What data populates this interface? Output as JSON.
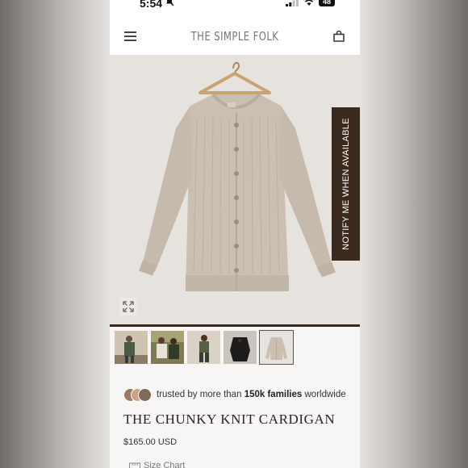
{
  "status_bar": {
    "time": "5:54",
    "battery": "48",
    "icons": [
      "bell-slash-icon",
      "signal-icon",
      "wifi-icon",
      "battery-icon"
    ]
  },
  "header": {
    "brand": "THE SIMPLE FOLK",
    "icons": [
      "menu-icon",
      "bag-icon"
    ]
  },
  "product_image": {
    "notify_label": "NOTIFY ME WHEN AVAILABLE",
    "icons": [
      "expand-icon"
    ]
  },
  "trust": {
    "prefix": "trusted by more than",
    "highlight": "150k families",
    "suffix": "worldwide"
  },
  "product": {
    "title": "THE CHUNKY KNIT CARDIGAN",
    "price": "$165.00 USD",
    "size_chart": "Size Chart"
  },
  "colors": {
    "brand_brown": "#3b2a1e",
    "cardigan": "#cbbfb1",
    "background": "#e6e3df"
  }
}
